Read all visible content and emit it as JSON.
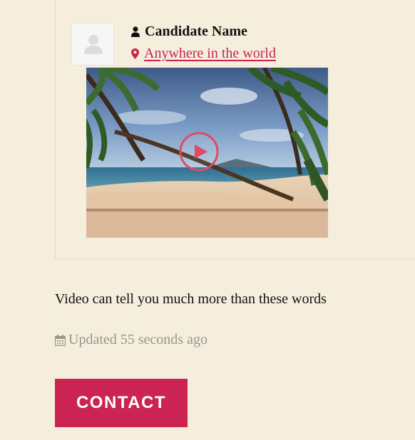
{
  "candidate": {
    "name": "Candidate Name",
    "location": "Anywhere in the world",
    "avatar_icon": "user-silhouette-icon"
  },
  "video": {
    "thumbnail": "tropical-beach-palm-trees",
    "play_icon": "play-icon"
  },
  "description": "Video can tell you much more than these words",
  "updated": {
    "text": "Updated 55 seconds ago",
    "icon": "calendar-icon"
  },
  "contact_button": {
    "label": "CONTACT"
  },
  "colors": {
    "background": "#f5eedd",
    "accent": "#cc2452",
    "link": "#c9244f",
    "muted_text": "#9a958d"
  }
}
